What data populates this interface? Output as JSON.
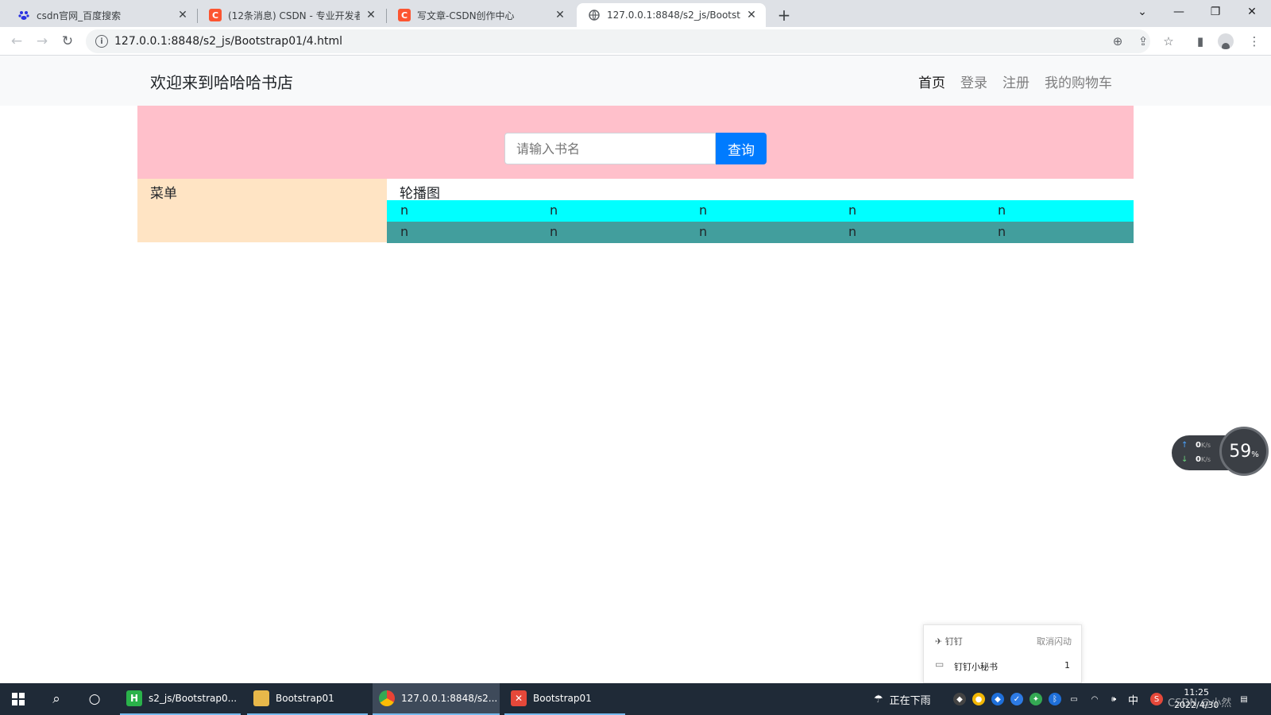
{
  "browser": {
    "tabs": [
      {
        "title": "csdn官网_百度搜索",
        "icon": "baidu-icon"
      },
      {
        "title": "(12条消息) CSDN - 专业开发者社",
        "icon": "csdn-icon"
      },
      {
        "title": "写文章-CSDN创作中心",
        "icon": "csdn-icon"
      },
      {
        "title": "127.0.0.1:8848/s2_js/Bootstrap",
        "icon": "globe-icon"
      }
    ],
    "url": "127.0.0.1:8848/s2_js/Bootstrap01/4.html"
  },
  "navbar": {
    "brand": "欢迎来到哈哈哈书店",
    "links": [
      "首页",
      "登录",
      "注册",
      "我的购物车"
    ]
  },
  "search": {
    "placeholder": "请输入书名",
    "button": "查询"
  },
  "layout": {
    "menu_label": "菜单",
    "carousel_label": "轮播图",
    "row1": [
      "n",
      "n",
      "n",
      "n",
      "n"
    ],
    "row2": [
      "n",
      "n",
      "n",
      "n",
      "n"
    ]
  },
  "colors": {
    "search_band": "#ffc0cb",
    "menu": "#ffe4c4",
    "row_cyan": "#00ffff",
    "row_teal": "#429e9d",
    "button": "#007bff"
  },
  "netmon": {
    "up": "0",
    "down": "0",
    "unit": "K/s",
    "percent": "59",
    "percent_sign": "%"
  },
  "notification": {
    "app": "钉钉",
    "stop": "取消闪动",
    "message": "钉钉小秘书",
    "count": "1"
  },
  "taskbar": {
    "apps": [
      {
        "label": "s2_js/Bootstrap0..."
      },
      {
        "label": "Bootstrap01"
      },
      {
        "label": "127.0.0.1:8848/s2..."
      },
      {
        "label": "Bootstrap01"
      }
    ],
    "weather": "正在下雨",
    "ime": "中",
    "time": "11:25",
    "date": "2022/4/30"
  },
  "watermark": "CSDN @小然"
}
